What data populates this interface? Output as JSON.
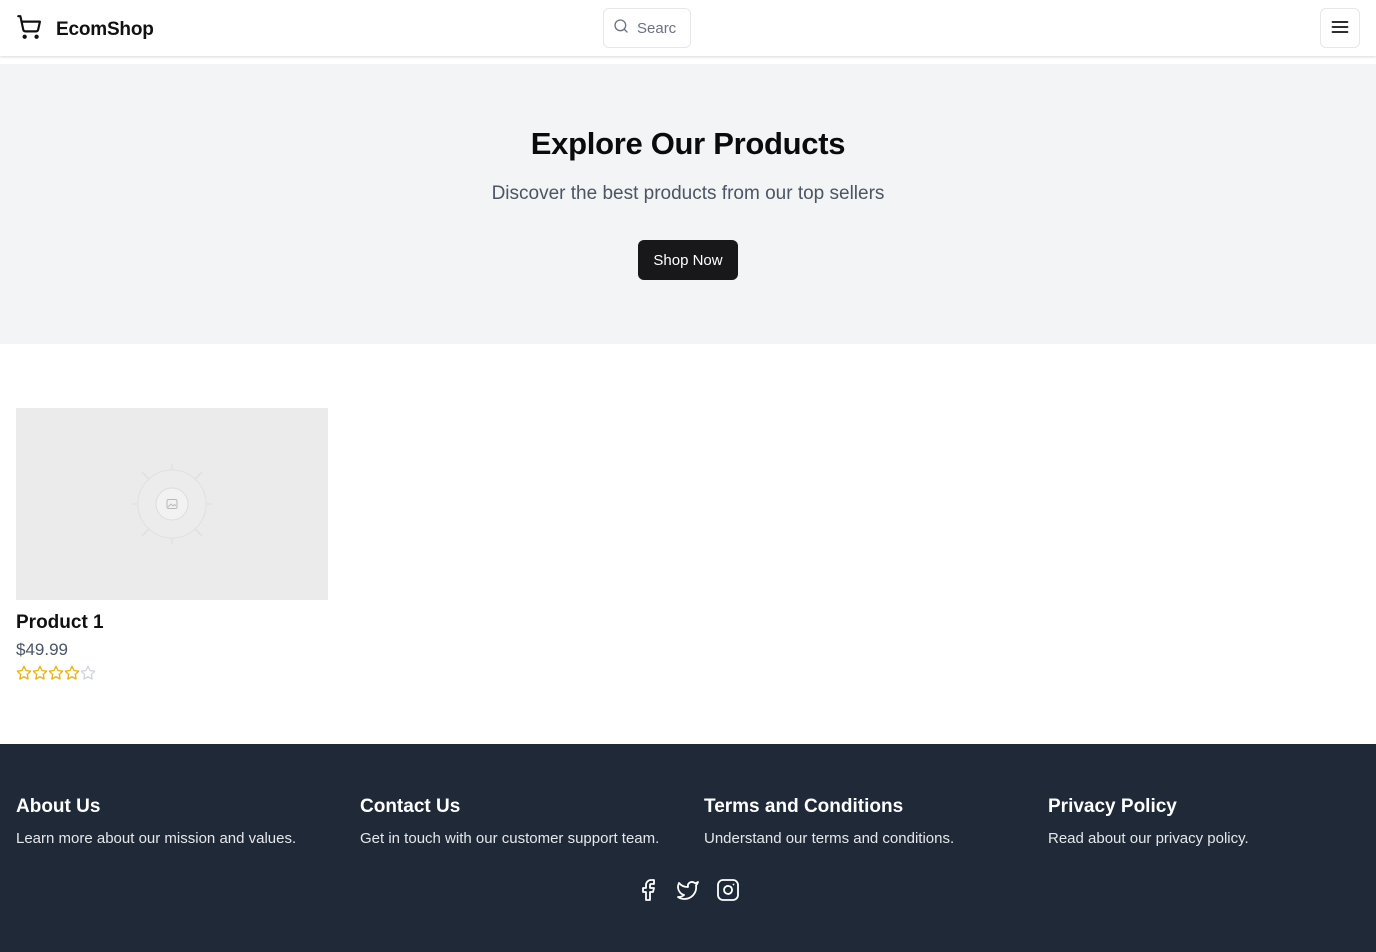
{
  "header": {
    "brand": "EcomShop",
    "search_placeholder": "Search"
  },
  "hero": {
    "title": "Explore Our Products",
    "subtitle": "Discover the best products from our top sellers",
    "cta_label": "Shop Now"
  },
  "products": [
    {
      "name": "Product 1",
      "price": "$49.99",
      "rating": 4,
      "max_rating": 5
    }
  ],
  "footer": {
    "columns": [
      {
        "title": "About Us",
        "text": "Learn more about our mission and values."
      },
      {
        "title": "Contact Us",
        "text": "Get in touch with our customer support team."
      },
      {
        "title": "Terms and Conditions",
        "text": "Understand our terms and conditions."
      },
      {
        "title": "Privacy Policy",
        "text": "Read about our privacy policy."
      }
    ],
    "socials": [
      "facebook-icon",
      "twitter-icon",
      "instagram-icon"
    ]
  },
  "colors": {
    "footer_bg": "#1f2937",
    "hero_bg": "#f3f4f6",
    "button_bg": "#18181b",
    "star_filled": "#eab308",
    "star_empty": "#d1d5db"
  }
}
